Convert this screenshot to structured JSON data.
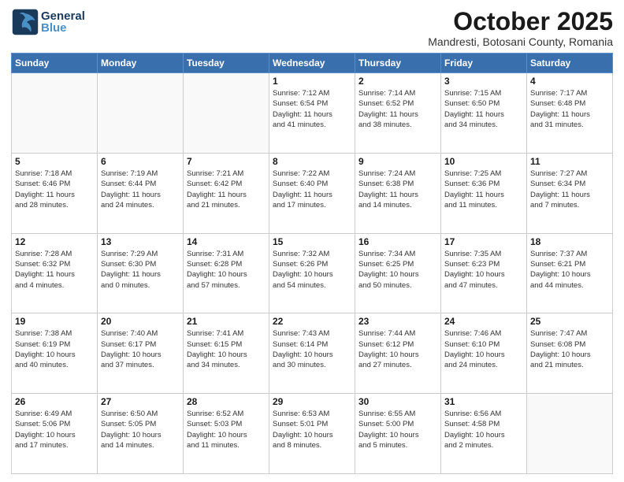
{
  "header": {
    "logo_general": "General",
    "logo_blue": "Blue",
    "month_title": "October 2025",
    "subtitle": "Mandresti, Botosani County, Romania"
  },
  "weekdays": [
    "Sunday",
    "Monday",
    "Tuesday",
    "Wednesday",
    "Thursday",
    "Friday",
    "Saturday"
  ],
  "weeks": [
    [
      {
        "day": "",
        "info": ""
      },
      {
        "day": "",
        "info": ""
      },
      {
        "day": "",
        "info": ""
      },
      {
        "day": "1",
        "info": "Sunrise: 7:12 AM\nSunset: 6:54 PM\nDaylight: 11 hours\nand 41 minutes."
      },
      {
        "day": "2",
        "info": "Sunrise: 7:14 AM\nSunset: 6:52 PM\nDaylight: 11 hours\nand 38 minutes."
      },
      {
        "day": "3",
        "info": "Sunrise: 7:15 AM\nSunset: 6:50 PM\nDaylight: 11 hours\nand 34 minutes."
      },
      {
        "day": "4",
        "info": "Sunrise: 7:17 AM\nSunset: 6:48 PM\nDaylight: 11 hours\nand 31 minutes."
      }
    ],
    [
      {
        "day": "5",
        "info": "Sunrise: 7:18 AM\nSunset: 6:46 PM\nDaylight: 11 hours\nand 28 minutes."
      },
      {
        "day": "6",
        "info": "Sunrise: 7:19 AM\nSunset: 6:44 PM\nDaylight: 11 hours\nand 24 minutes."
      },
      {
        "day": "7",
        "info": "Sunrise: 7:21 AM\nSunset: 6:42 PM\nDaylight: 11 hours\nand 21 minutes."
      },
      {
        "day": "8",
        "info": "Sunrise: 7:22 AM\nSunset: 6:40 PM\nDaylight: 11 hours\nand 17 minutes."
      },
      {
        "day": "9",
        "info": "Sunrise: 7:24 AM\nSunset: 6:38 PM\nDaylight: 11 hours\nand 14 minutes."
      },
      {
        "day": "10",
        "info": "Sunrise: 7:25 AM\nSunset: 6:36 PM\nDaylight: 11 hours\nand 11 minutes."
      },
      {
        "day": "11",
        "info": "Sunrise: 7:27 AM\nSunset: 6:34 PM\nDaylight: 11 hours\nand 7 minutes."
      }
    ],
    [
      {
        "day": "12",
        "info": "Sunrise: 7:28 AM\nSunset: 6:32 PM\nDaylight: 11 hours\nand 4 minutes."
      },
      {
        "day": "13",
        "info": "Sunrise: 7:29 AM\nSunset: 6:30 PM\nDaylight: 11 hours\nand 0 minutes."
      },
      {
        "day": "14",
        "info": "Sunrise: 7:31 AM\nSunset: 6:28 PM\nDaylight: 10 hours\nand 57 minutes."
      },
      {
        "day": "15",
        "info": "Sunrise: 7:32 AM\nSunset: 6:26 PM\nDaylight: 10 hours\nand 54 minutes."
      },
      {
        "day": "16",
        "info": "Sunrise: 7:34 AM\nSunset: 6:25 PM\nDaylight: 10 hours\nand 50 minutes."
      },
      {
        "day": "17",
        "info": "Sunrise: 7:35 AM\nSunset: 6:23 PM\nDaylight: 10 hours\nand 47 minutes."
      },
      {
        "day": "18",
        "info": "Sunrise: 7:37 AM\nSunset: 6:21 PM\nDaylight: 10 hours\nand 44 minutes."
      }
    ],
    [
      {
        "day": "19",
        "info": "Sunrise: 7:38 AM\nSunset: 6:19 PM\nDaylight: 10 hours\nand 40 minutes."
      },
      {
        "day": "20",
        "info": "Sunrise: 7:40 AM\nSunset: 6:17 PM\nDaylight: 10 hours\nand 37 minutes."
      },
      {
        "day": "21",
        "info": "Sunrise: 7:41 AM\nSunset: 6:15 PM\nDaylight: 10 hours\nand 34 minutes."
      },
      {
        "day": "22",
        "info": "Sunrise: 7:43 AM\nSunset: 6:14 PM\nDaylight: 10 hours\nand 30 minutes."
      },
      {
        "day": "23",
        "info": "Sunrise: 7:44 AM\nSunset: 6:12 PM\nDaylight: 10 hours\nand 27 minutes."
      },
      {
        "day": "24",
        "info": "Sunrise: 7:46 AM\nSunset: 6:10 PM\nDaylight: 10 hours\nand 24 minutes."
      },
      {
        "day": "25",
        "info": "Sunrise: 7:47 AM\nSunset: 6:08 PM\nDaylight: 10 hours\nand 21 minutes."
      }
    ],
    [
      {
        "day": "26",
        "info": "Sunrise: 6:49 AM\nSunset: 5:06 PM\nDaylight: 10 hours\nand 17 minutes."
      },
      {
        "day": "27",
        "info": "Sunrise: 6:50 AM\nSunset: 5:05 PM\nDaylight: 10 hours\nand 14 minutes."
      },
      {
        "day": "28",
        "info": "Sunrise: 6:52 AM\nSunset: 5:03 PM\nDaylight: 10 hours\nand 11 minutes."
      },
      {
        "day": "29",
        "info": "Sunrise: 6:53 AM\nSunset: 5:01 PM\nDaylight: 10 hours\nand 8 minutes."
      },
      {
        "day": "30",
        "info": "Sunrise: 6:55 AM\nSunset: 5:00 PM\nDaylight: 10 hours\nand 5 minutes."
      },
      {
        "day": "31",
        "info": "Sunrise: 6:56 AM\nSunset: 4:58 PM\nDaylight: 10 hours\nand 2 minutes."
      },
      {
        "day": "",
        "info": ""
      }
    ]
  ]
}
